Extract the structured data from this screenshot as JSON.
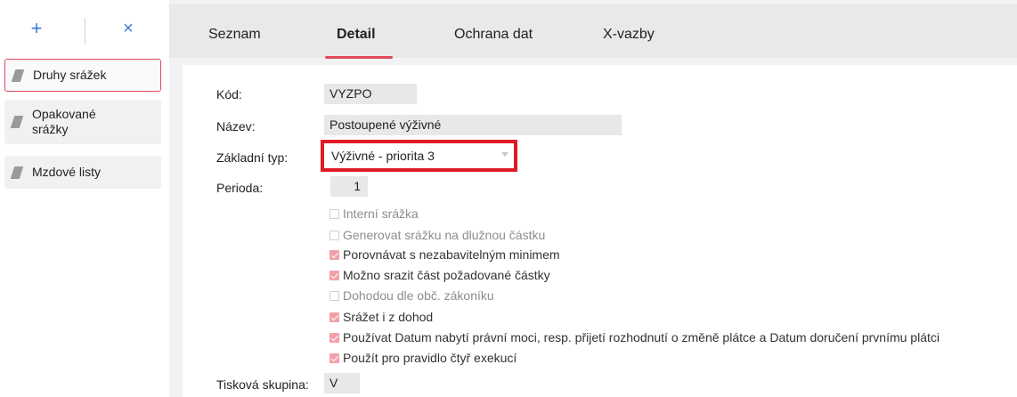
{
  "toolbar": {
    "add_label": "+",
    "close_label": "×"
  },
  "sidebar": {
    "items": [
      {
        "label": "Druhy srážek"
      },
      {
        "label": "Opakované srážky"
      },
      {
        "label": "Mzdové listy"
      }
    ]
  },
  "tabs": [
    {
      "label": "Seznam"
    },
    {
      "label": "Detail"
    },
    {
      "label": "Ochrana dat"
    },
    {
      "label": "X-vazby"
    }
  ],
  "form": {
    "kod": {
      "label": "Kód:",
      "value": "VYZPO"
    },
    "nazev": {
      "label": "Název:",
      "value": "Postoupené výživné"
    },
    "zakladni_typ": {
      "label": "Základní typ:",
      "value": "Výživné - priorita 3"
    },
    "perioda": {
      "label": "Perioda:",
      "value": "1"
    },
    "tiskova_skupina": {
      "label": "Tisková skupina:",
      "value": "V"
    }
  },
  "checkboxes": [
    {
      "label": "Interní srážka",
      "checked": false,
      "disabled": true
    },
    {
      "label": "Generovat srážku na dlužnou částku",
      "checked": false,
      "disabled": true
    },
    {
      "label": "Porovnávat s nezabavitelným minimem",
      "checked": true,
      "disabled": false
    },
    {
      "label": "Možno srazit část požadované částky",
      "checked": true,
      "disabled": false
    },
    {
      "label": "Dohodou dle obč. zákoníku",
      "checked": false,
      "disabled": true
    },
    {
      "label": "Srážet i z dohod",
      "checked": true,
      "disabled": false
    },
    {
      "label": "Používat Datum nabytí právní moci, resp. přijetí rozhodnutí o změně plátce a Datum doručení prvnímu plátci",
      "checked": true,
      "disabled": false
    },
    {
      "label": "Použít pro pravidlo čtyř exekucí",
      "checked": true,
      "disabled": false
    }
  ],
  "colors": {
    "accent": "#e04a5c",
    "highlight_border": "#e01b24",
    "icon_blue": "#3a7bd5"
  }
}
